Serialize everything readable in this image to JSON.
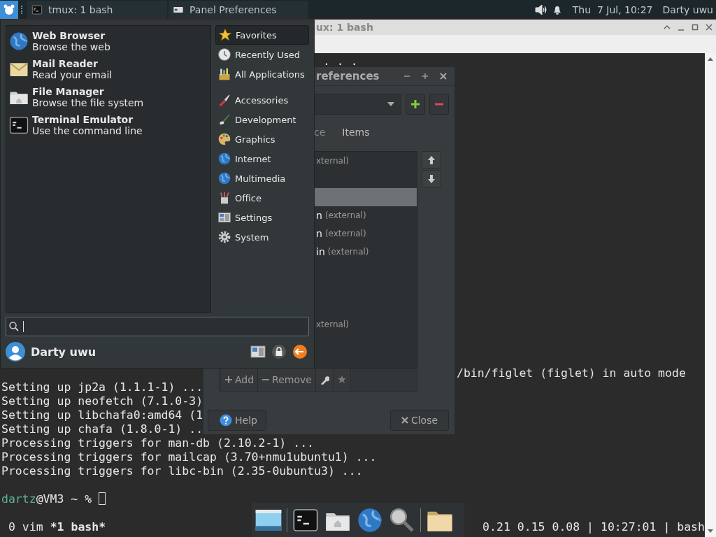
{
  "top_panel": {
    "tasks": [
      {
        "kind": "terminal",
        "title": "tmux: 1 bash"
      },
      {
        "kind": "window",
        "title": "Panel Preferences"
      }
    ],
    "clock": "Thu  7 Jul, 10:27",
    "user": "Darty uwu"
  },
  "terminal_window": {
    "title": "ux: 1 bash",
    "top_lines": [
      {
        "kind": "tail",
        "text": ". . ."
      }
    ],
    "lines": [
      {
        "kind": "tail",
        "text": "/bin/figlet (figlet) in auto mode"
      },
      {
        "kind": "full",
        "text": "Setting up jp2a (1.1.1-1) ..."
      },
      {
        "kind": "full",
        "text": "Setting up neofetch (7.1.0-3)"
      },
      {
        "kind": "full",
        "text": "Setting up libchafa0:amd64 (1"
      },
      {
        "kind": "full",
        "text": "Setting up chafa (1.8.0-1) .."
      },
      {
        "kind": "full",
        "text": "Processing triggers for man-db (2.10.2-1) ..."
      },
      {
        "kind": "full",
        "text": "Processing triggers for mailcap (3.70+nmu1ubuntu1) ..."
      },
      {
        "kind": "full",
        "text": "Processing triggers for libc-bin (2.35-0ubuntu3) ..."
      }
    ],
    "prompt": {
      "user": "dartz",
      "rest": "@VM3 ~ %"
    },
    "status_windows": [
      {
        "label": "0 vim",
        "selected": false
      },
      {
        "label": "*1 bash*",
        "selected": true
      }
    ],
    "status_right": "0.21 0.15 0.08 | 10:27:01 | bash"
  },
  "prefs_window": {
    "title": "references",
    "tabs": [
      {
        "label": "ce",
        "selected": false
      },
      {
        "label": "Items",
        "selected": true
      }
    ],
    "items": [
      {
        "note": "xternal)",
        "selected": false
      },
      {
        "selected": false
      },
      {
        "selected": true
      },
      {
        "name": "n",
        "note": "(external)",
        "selected": false
      },
      {
        "name": "n",
        "note": "(external)",
        "selected": false
      },
      {
        "name": "in",
        "note": "(external)",
        "selected": false
      },
      {
        "selected": false
      },
      {
        "selected": false
      },
      {
        "selected": false
      },
      {
        "note": "xternal)",
        "selected": false
      },
      {
        "selected": false
      }
    ],
    "toolbar": [
      {
        "kind": "add",
        "label": "Add"
      },
      {
        "kind": "remove",
        "label": "Remove"
      },
      {
        "kind": "wrench"
      },
      {
        "kind": "star"
      }
    ],
    "help": "Help",
    "close": "Close"
  },
  "app_menu": {
    "favorites": [
      {
        "kind": "globe",
        "title": "Web Browser",
        "subtitle": "Browse the web"
      },
      {
        "kind": "mail",
        "title": "Mail Reader",
        "subtitle": "Read your email"
      },
      {
        "kind": "folder",
        "title": "File Manager",
        "subtitle": "Browse the file system"
      },
      {
        "kind": "terminal",
        "title": "Terminal Emulator",
        "subtitle": "Use the command line"
      }
    ],
    "category_groups": [
      {
        "items": [
          {
            "kind": "star",
            "label": "Favorites",
            "selected": true
          },
          {
            "kind": "clock",
            "label": "Recently Used",
            "selected": false
          },
          {
            "kind": "apps",
            "label": "All Applications",
            "selected": false
          }
        ]
      },
      {
        "items": [
          {
            "kind": "knife",
            "label": "Accessories",
            "selected": false
          },
          {
            "kind": "brush",
            "label": "Development",
            "selected": false
          },
          {
            "kind": "palette",
            "label": "Graphics",
            "selected": false
          },
          {
            "kind": "globe",
            "label": "Internet",
            "selected": false
          },
          {
            "kind": "globe",
            "label": "Multimedia",
            "selected": false
          },
          {
            "kind": "pens",
            "label": "Office",
            "selected": false
          },
          {
            "kind": "panel",
            "label": "Settings",
            "selected": false
          },
          {
            "kind": "gear",
            "label": "System",
            "selected": false
          }
        ]
      }
    ],
    "user": "Darty uwu"
  },
  "dock": {
    "items": [
      {
        "kind": "display"
      },
      {
        "kind": "separator"
      },
      {
        "kind": "terminal"
      },
      {
        "kind": "home"
      },
      {
        "kind": "globe"
      },
      {
        "kind": "magnifier"
      },
      {
        "kind": "separator"
      },
      {
        "kind": "folder"
      }
    ]
  }
}
